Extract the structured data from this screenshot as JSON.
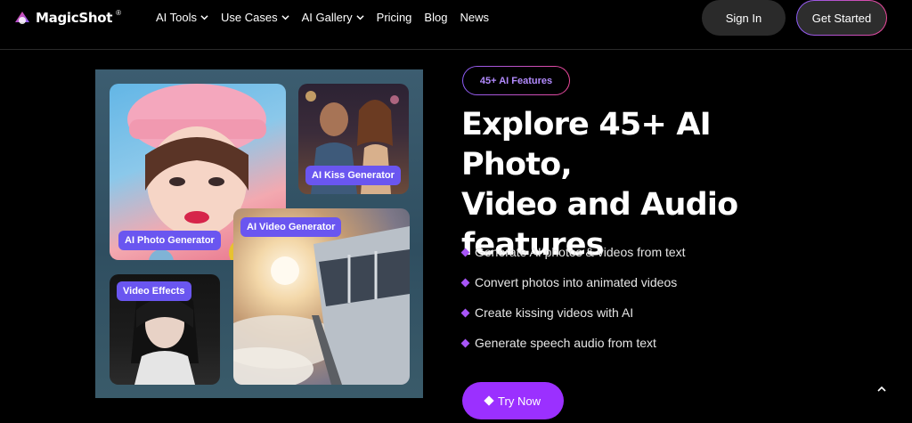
{
  "nav": {
    "brand": "MagicShot",
    "brand_reg": "®",
    "menu": [
      {
        "label": "AI Tools",
        "dropdown": true
      },
      {
        "label": "Use Cases",
        "dropdown": true
      },
      {
        "label": "AI Gallery",
        "dropdown": true
      },
      {
        "label": "Pricing",
        "dropdown": false
      },
      {
        "label": "Blog",
        "dropdown": false
      },
      {
        "label": "News",
        "dropdown": false
      }
    ],
    "signin_label": "Sign In",
    "get_started_label": "Get Started"
  },
  "collage": {
    "tags": {
      "photo": "AI Photo Generator",
      "kiss": "AI Kiss Generator",
      "video": "AI Video Generator",
      "effects": "Video Effects"
    }
  },
  "hero": {
    "badge": "45+ AI Features",
    "headline_lines": [
      "Explore 45+ AI Photo,",
      "Video and Audio",
      "features"
    ],
    "features": [
      "Generate AI photos & videos from text",
      "Convert photos into animated videos",
      "Create kissing videos with AI",
      "Generate speech audio from text"
    ],
    "cta_label": "Try Now"
  },
  "colors": {
    "accent": "#9b30ff",
    "tag_bg": "#6a56f0",
    "badge_text": "#b38bff",
    "gradient_start": "#8b5cf6",
    "gradient_end": "#ec4899"
  },
  "icons": {
    "logo": "magicshot-logo-icon",
    "dropdown": "chevron-down-icon",
    "bullet": "diamond-bullet-icon",
    "cta": "sparkle-icon",
    "scroll": "chevron-up-icon"
  }
}
